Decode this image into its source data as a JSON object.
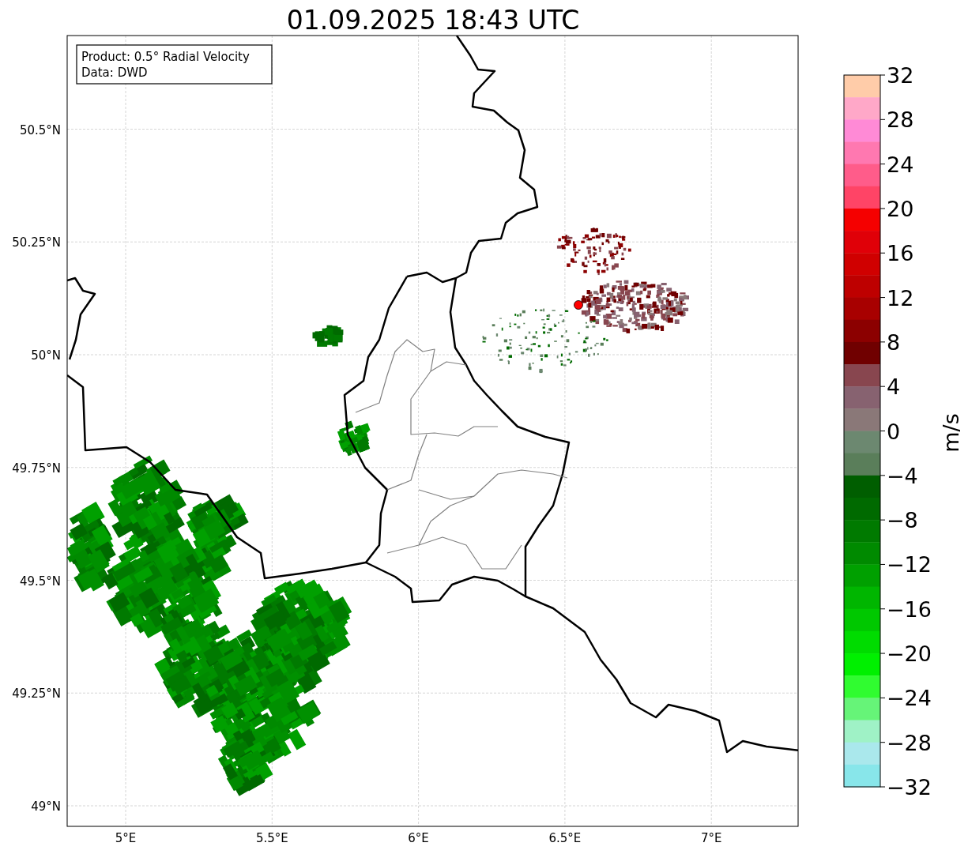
{
  "title": "01.09.2025 18:43 UTC",
  "map": {
    "legend": [
      "Product: 0.5° Radial Velocity",
      "Data: DWD"
    ],
    "latitude_labels": [
      "50.5°N",
      "50.25°N",
      "50°N",
      "49.75°N",
      "49.5°N",
      "49.25°N",
      "49°N"
    ],
    "longitude_labels": [
      "5°E",
      "5.5°E",
      "6°E",
      "6.5°E",
      "7°E"
    ]
  },
  "colorbar": {
    "label": "m/s",
    "ticks": [
      "32",
      "28",
      "24",
      "20",
      "16",
      "12",
      "8",
      "4",
      "0",
      "−4",
      "−8",
      "−12",
      "−16",
      "−20",
      "−24",
      "−28",
      "−32"
    ],
    "segments": [
      {
        "color": "#ffcca9"
      },
      {
        "color": "#ffa8c8"
      },
      {
        "color": "#ff8ad6"
      },
      {
        "color": "#ff78b0"
      },
      {
        "color": "#ff5c8a"
      },
      {
        "color": "#ff4466"
      },
      {
        "color": "#f50000"
      },
      {
        "color": "#e00008"
      },
      {
        "color": "#d00000"
      },
      {
        "color": "#be0000"
      },
      {
        "color": "#a80000"
      },
      {
        "color": "#8c0000"
      },
      {
        "color": "#700000"
      },
      {
        "color": "#88464f"
      },
      {
        "color": "#876270"
      },
      {
        "color": "#8a7878"
      },
      {
        "color": "#6c8870"
      },
      {
        "color": "#5a7e5a"
      },
      {
        "color": "#005e00"
      },
      {
        "color": "#006a00"
      },
      {
        "color": "#007a00"
      },
      {
        "color": "#008a00"
      },
      {
        "color": "#00a000"
      },
      {
        "color": "#00b600"
      },
      {
        "color": "#00c800"
      },
      {
        "color": "#00dc00"
      },
      {
        "color": "#00f000"
      },
      {
        "color": "#30fc30"
      },
      {
        "color": "#66f478"
      },
      {
        "color": "#9ff2c6"
      },
      {
        "color": "#aae8ec"
      },
      {
        "color": "#88e6ea"
      }
    ]
  }
}
